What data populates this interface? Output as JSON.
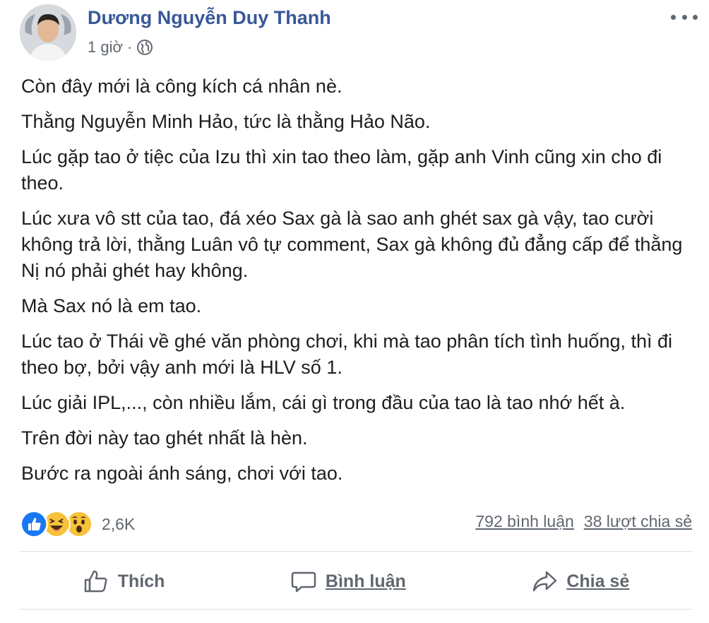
{
  "author": {
    "name": "Dương Nguyễn Duy Thanh",
    "time": "1 giờ",
    "separator": "·"
  },
  "icons": {
    "privacy": "globe-icon",
    "menu": "more-options-icon",
    "reactions": [
      "like-icon",
      "haha-icon",
      "wow-icon"
    ],
    "like": "thumbs-up-icon",
    "comment": "comment-bubble-icon",
    "share": "share-arrow-icon"
  },
  "post": {
    "paragraphs": [
      "Còn đây mới là công kích cá nhân nè.",
      "Thằng Nguyễn Minh Hảo, tức là thằng Hảo Não.",
      "Lúc gặp tao ở tiệc của Izu thì xin tao theo làm, gặp anh Vinh cũng xin cho đi theo.",
      "Lúc xưa vô stt của tao, đá xéo Sax gà là sao anh ghét sax gà vậy, tao cười không trả lời, thằng Luân vô tự comment, Sax gà không đủ đẳng cấp để thằng Nị nó phải ghét hay không.",
      "Mà Sax nó là em tao.",
      "Lúc tao ở Thái về ghé văn phòng chơi, khi mà tao phân tích tình huống, thì đi theo bợ, bởi vậy anh mới là HLV số 1.",
      "Lúc giải IPL,..., còn nhiều lắm, cái gì trong đầu của tao là tao nhớ hết à.",
      "Trên đời này tao ghét nhất là hèn.",
      "Bước ra ngoài ánh sáng, chơi với tao."
    ]
  },
  "engagement": {
    "reaction_count": "2,6K",
    "comments": "792 bình luận",
    "shares": "38 lượt chia sẻ"
  },
  "actions": {
    "like": "Thích",
    "comment": "Bình luận",
    "share": "Chia sẻ"
  },
  "colors": {
    "author_name": "#385898",
    "secondary_text": "#606770",
    "like_blue": "#1877f2",
    "emoji_yellow": "#f7c23b",
    "divider": "#dadde1"
  }
}
